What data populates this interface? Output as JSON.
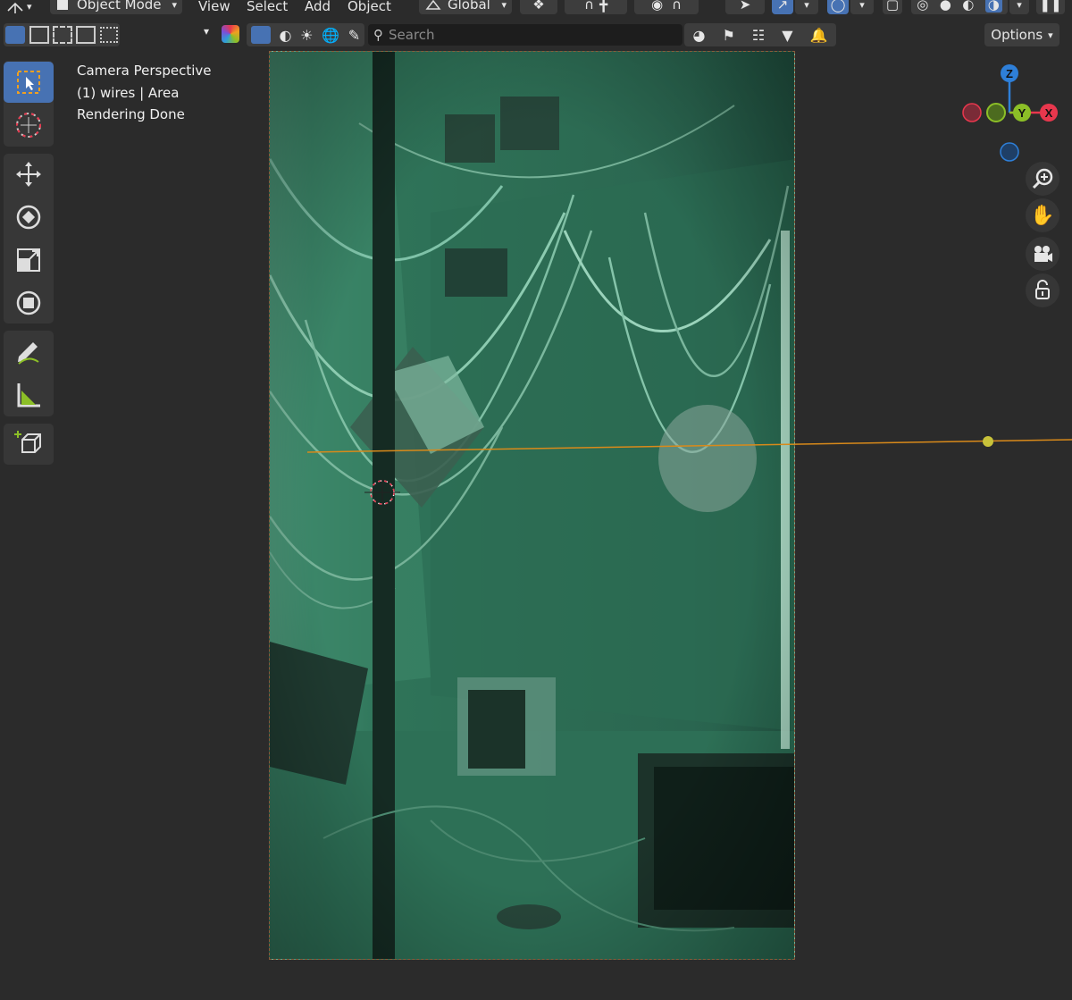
{
  "header": {
    "mode_label": "Object Mode",
    "menus": [
      "View",
      "Select",
      "Add",
      "Object"
    ],
    "orientation_label": "Global"
  },
  "outliner_bar": {
    "search_placeholder": "Search",
    "options_label": "Options"
  },
  "viewport": {
    "info_lines": [
      "Camera Perspective",
      "(1) wires | Area",
      "Rendering Done"
    ]
  },
  "gizmo": {
    "z_label": "Z",
    "y_label": "Y",
    "x_label": "X",
    "colors": {
      "x": "#e8374d",
      "y": "#8cbf27",
      "z": "#2e7fd8"
    }
  },
  "colors": {
    "accent": "#4772b3",
    "render_tint": "#2d6d54",
    "light_line": "#d98a1a",
    "light_dot": "#c8c23a"
  }
}
